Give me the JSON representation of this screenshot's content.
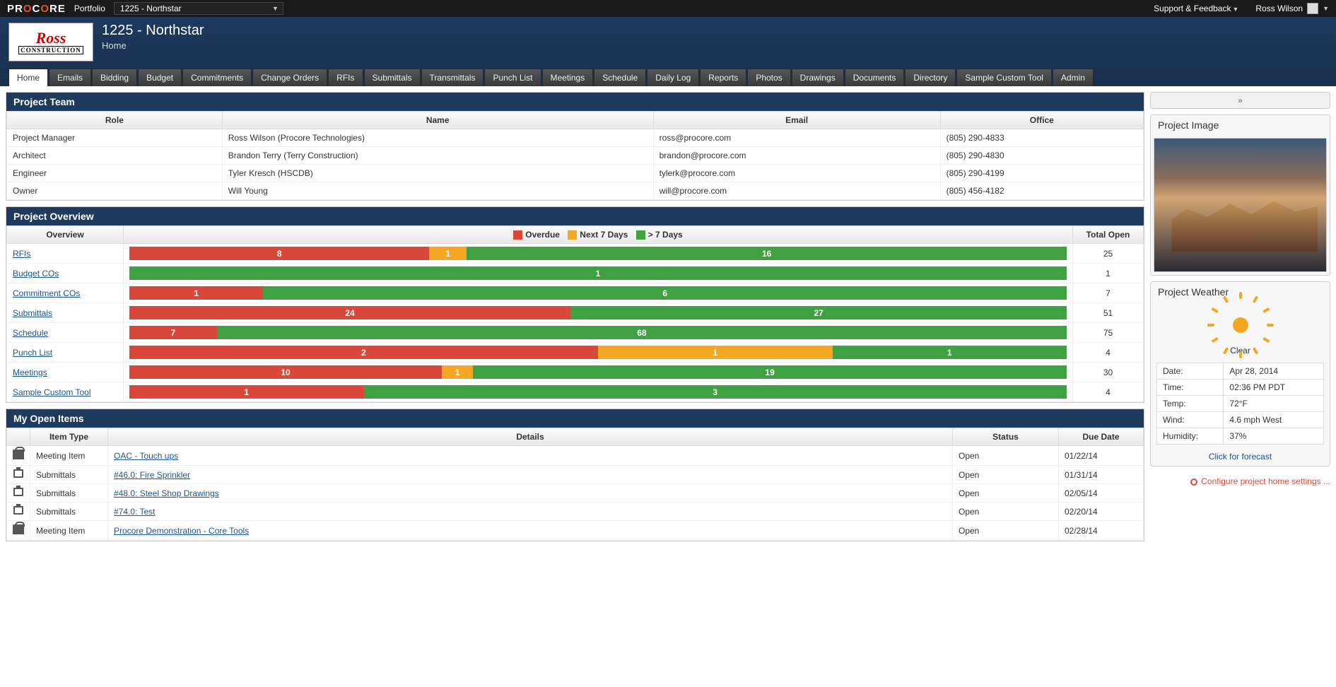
{
  "topbar": {
    "logo": "PROCORE",
    "portfolio_label": "Portfolio",
    "project_selector": "1225 - Northstar",
    "support_label": "Support & Feedback",
    "user_name": "Ross Wilson"
  },
  "header": {
    "company": "Ross",
    "company_sub": "CONSTRUCTION",
    "project_title": "1225 - Northstar",
    "breadcrumb": "Home"
  },
  "tabs": [
    "Home",
    "Emails",
    "Bidding",
    "Budget",
    "Commitments",
    "Change Orders",
    "RFIs",
    "Submittals",
    "Transmittals",
    "Punch List",
    "Meetings",
    "Schedule",
    "Daily Log",
    "Reports",
    "Photos",
    "Drawings",
    "Documents",
    "Directory",
    "Sample Custom Tool",
    "Admin"
  ],
  "team": {
    "title": "Project Team",
    "cols": [
      "Role",
      "Name",
      "Email",
      "Office"
    ],
    "rows": [
      {
        "role": "Project Manager",
        "name": "Ross Wilson (Procore Technologies)",
        "email": "ross@procore.com",
        "office": "(805) 290-4833"
      },
      {
        "role": "Architect",
        "name": "Brandon Terry (Terry Construction)",
        "email": "brandon@procore.com",
        "office": "(805) 290-4830"
      },
      {
        "role": "Engineer",
        "name": "Tyler Kresch (HSCDB)",
        "email": "tylerk@procore.com",
        "office": "(805) 290-4199"
      },
      {
        "role": "Owner",
        "name": "Will Young",
        "email": "will@procore.com",
        "office": "(805) 456-4182"
      }
    ]
  },
  "overview": {
    "title": "Project Overview",
    "col_overview": "Overview",
    "legend": {
      "overdue": "Overdue",
      "next7": "Next 7 Days",
      "gt7": "> 7 Days"
    },
    "col_total": "Total Open",
    "rows": [
      {
        "name": "RFIs",
        "overdue": 8,
        "next7": 1,
        "gt7": 16,
        "total": 25
      },
      {
        "name": "Budget COs",
        "overdue": 0,
        "next7": 0,
        "gt7": 1,
        "total": 1
      },
      {
        "name": "Commitment COs",
        "overdue": 1,
        "next7": 0,
        "gt7": 6,
        "total": 7
      },
      {
        "name": "Submittals",
        "overdue": 24,
        "next7": 0,
        "gt7": 27,
        "total": 51
      },
      {
        "name": "Schedule",
        "overdue": 7,
        "next7": 0,
        "gt7": 68,
        "total": 75
      },
      {
        "name": "Punch List",
        "overdue": 2,
        "next7": 1,
        "gt7": 1,
        "total": 4
      },
      {
        "name": "Meetings",
        "overdue": 10,
        "next7": 1,
        "gt7": 19,
        "total": 30
      },
      {
        "name": "Sample Custom Tool",
        "overdue": 1,
        "next7": 0,
        "gt7": 3,
        "total": 4
      }
    ]
  },
  "open_items": {
    "title": "My Open Items",
    "cols": [
      "",
      "Item Type",
      "Details",
      "Status",
      "Due Date"
    ],
    "rows": [
      {
        "icon": "meeting",
        "type": "Meeting Item",
        "details": "OAC - Touch ups",
        "status": "Open",
        "due": "01/22/14"
      },
      {
        "icon": "submittal",
        "type": "Submittals",
        "details": "#46.0: Fire Sprinkler",
        "status": "Open",
        "due": "01/31/14"
      },
      {
        "icon": "submittal",
        "type": "Submittals",
        "details": "#48.0: Steel Shop Drawings",
        "status": "Open",
        "due": "02/05/14"
      },
      {
        "icon": "submittal",
        "type": "Submittals",
        "details": "#74.0: Test",
        "status": "Open",
        "due": "02/20/14"
      },
      {
        "icon": "meeting",
        "type": "Meeting Item",
        "details": "Procore Demonstration - Core Tools",
        "status": "Open",
        "due": "02/28/14"
      }
    ]
  },
  "side": {
    "image_title": "Project Image",
    "weather_title": "Project Weather",
    "weather_cond": "Clear",
    "weather": [
      {
        "k": "Date:",
        "v": "Apr 28, 2014"
      },
      {
        "k": "Time:",
        "v": "02:36 PM PDT"
      },
      {
        "k": "Temp:",
        "v": "72°F"
      },
      {
        "k": "Wind:",
        "v": "4.6 mph West"
      },
      {
        "k": "Humidity:",
        "v": "37%"
      }
    ],
    "forecast_link": "Click for forecast",
    "config_link": "Configure project home settings ..."
  }
}
